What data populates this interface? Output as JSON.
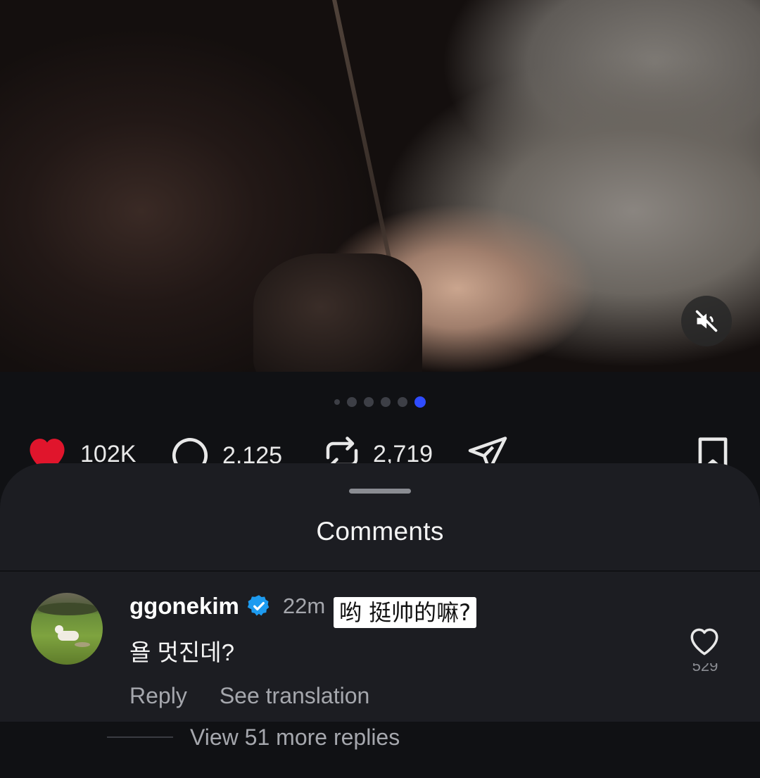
{
  "post": {
    "carousel": {
      "total": 6,
      "active_index": 5
    },
    "likes": "102K",
    "comments": "2,125",
    "reposts": "2,719"
  },
  "comments_sheet": {
    "title": "Comments",
    "comment": {
      "username": "ggonekim",
      "verified": true,
      "time": "22m",
      "text": "욜 멋진데?",
      "overlay_translation": "哟 挺帅的嘛?",
      "reply_label": "Reply",
      "see_translation_label": "See translation",
      "like_count": "529"
    },
    "view_more_label": "View 51 more replies"
  },
  "colors": {
    "background": "#101114",
    "sheet": "#1c1d22",
    "like_red": "#e0152c",
    "carousel_active": "#2f4cff",
    "verified_blue": "#1d9bf0",
    "secondary_text": "#a5a7ad"
  },
  "icons": [
    "volume-muted-icon",
    "heart-icon",
    "comment-icon",
    "repost-icon",
    "share-icon",
    "bookmark-icon",
    "verified-badge-icon",
    "like-outline-icon"
  ]
}
